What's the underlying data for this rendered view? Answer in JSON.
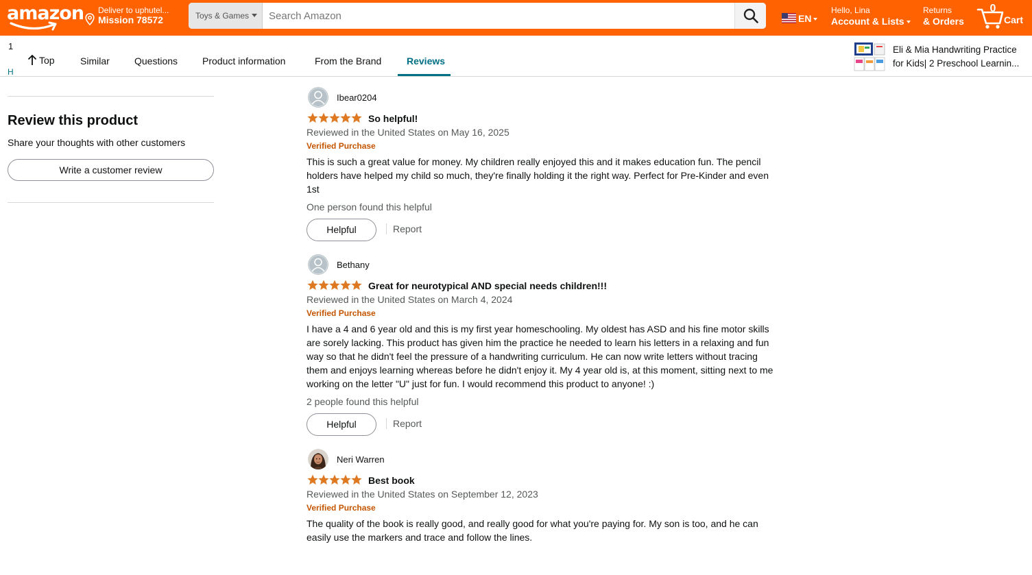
{
  "header": {
    "logo_text": "amazon",
    "deliver_line1": "Deliver to uphutel...",
    "deliver_line2": "Mission 78572",
    "search_category": "Toys & Games",
    "search_placeholder": "Search Amazon",
    "language": "EN",
    "account_line1": "Hello, Lina",
    "account_line2": "Account & Lists",
    "returns_line1": "Returns",
    "returns_line2": "& Orders",
    "cart_count": "0",
    "cart_label": "Cart",
    "accent_color": "#ff6200"
  },
  "subnav": {
    "number": "1",
    "letter": "H",
    "tabs": [
      {
        "label": "Top"
      },
      {
        "label": "Similar"
      },
      {
        "label": "Questions"
      },
      {
        "label": "Product information"
      },
      {
        "label": "From the Brand"
      },
      {
        "label": "Reviews"
      }
    ],
    "active_tab": "Reviews",
    "product_title_line1": "Eli & Mia Handwriting Practice",
    "product_title_line2": "for Kids| 2 Preschool Learnin..."
  },
  "left": {
    "heading": "Review this product",
    "subheading": "Share your thoughts with other customers",
    "button_label": "Write a customer review"
  },
  "reviews": [
    {
      "name": "Ibear0204",
      "avatar": "default-avatar-icon",
      "rating": 5,
      "title": "So helpful!",
      "date": "Reviewed in the United States on May 16, 2025",
      "verified": "Verified Purchase",
      "body": "This is such a great value for money. My children really enjoyed this and it makes education fun. The pencil holders have helped my child so much, they're finally holding it the right way. Perfect for Pre-Kinder and even 1st",
      "helpful_count": "One person found this helpful",
      "helpful_label": "Helpful",
      "report_label": "Report"
    },
    {
      "name": "Bethany",
      "avatar": "default-avatar-icon",
      "rating": 5,
      "title": "Great for neurotypical AND special needs children!!!",
      "date": "Reviewed in the United States on March 4, 2024",
      "verified": "Verified Purchase",
      "body": "I have a 4 and 6 year old and this is my first year homeschooling. My oldest has ASD and his fine motor skills are sorely lacking. This product has given him the practice he needed to learn his letters in a relaxing and fun way so that he didn't feel the pressure of a handwriting curriculum. He can now write letters without tracing them and enjoys learning whereas before he didn't enjoy it. My 4 year old is, at this moment, sitting next to me working on the letter \"U\" just for fun. I would recommend this product to anyone! :)",
      "helpful_count": "2 people found this helpful",
      "helpful_label": "Helpful",
      "report_label": "Report"
    },
    {
      "name": "Neri Warren",
      "avatar": "user-photo-avatar",
      "rating": 5,
      "title": "Best book",
      "date": "Reviewed in the United States on September 12, 2023",
      "verified": "Verified Purchase",
      "body": "The quality of the book is really good, and really good for what you're paying for. My son is too, and he can easily use the markers and trace and follow the lines."
    }
  ],
  "colors": {
    "star": "#de7921",
    "link": "#007185",
    "verified": "#c45500"
  }
}
